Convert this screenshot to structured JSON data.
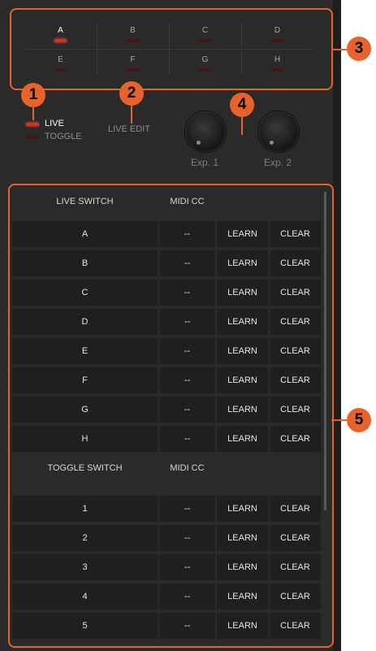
{
  "colors": {
    "accent": "#e8632b",
    "panel": "#2a2a2a",
    "led_on": "#d63125",
    "led_off": "#4a1414"
  },
  "switches": [
    {
      "label": "A",
      "active": true
    },
    {
      "label": "B",
      "active": false
    },
    {
      "label": "C",
      "active": false
    },
    {
      "label": "D",
      "active": false
    },
    {
      "label": "E",
      "active": false
    },
    {
      "label": "F",
      "active": false
    },
    {
      "label": "G",
      "active": false
    },
    {
      "label": "H",
      "active": false
    }
  ],
  "callouts": [
    "1",
    "2",
    "3",
    "4",
    "5"
  ],
  "modes": {
    "live": "LIVE",
    "toggle": "TOGGLE",
    "live_edit": "LIVE EDIT"
  },
  "expression": {
    "exp1": "Exp. 1",
    "exp2": "Exp. 2"
  },
  "live_section": {
    "header_name": "LIVE SWITCH",
    "header_cc": "MIDI CC",
    "rows": [
      {
        "name": "A",
        "cc": "--",
        "learn": "LEARN",
        "clear": "CLEAR"
      },
      {
        "name": "B",
        "cc": "--",
        "learn": "LEARN",
        "clear": "CLEAR"
      },
      {
        "name": "C",
        "cc": "--",
        "learn": "LEARN",
        "clear": "CLEAR"
      },
      {
        "name": "D",
        "cc": "--",
        "learn": "LEARN",
        "clear": "CLEAR"
      },
      {
        "name": "E",
        "cc": "--",
        "learn": "LEARN",
        "clear": "CLEAR"
      },
      {
        "name": "F",
        "cc": "--",
        "learn": "LEARN",
        "clear": "CLEAR"
      },
      {
        "name": "G",
        "cc": "--",
        "learn": "LEARN",
        "clear": "CLEAR"
      },
      {
        "name": "H",
        "cc": "--",
        "learn": "LEARN",
        "clear": "CLEAR"
      }
    ]
  },
  "toggle_section": {
    "header_name": "TOGGLE SWITCH",
    "header_cc": "MIDI CC",
    "rows": [
      {
        "name": "1",
        "cc": "--",
        "learn": "LEARN",
        "clear": "CLEAR"
      },
      {
        "name": "2",
        "cc": "--",
        "learn": "LEARN",
        "clear": "CLEAR"
      },
      {
        "name": "3",
        "cc": "--",
        "learn": "LEARN",
        "clear": "CLEAR"
      },
      {
        "name": "4",
        "cc": "--",
        "learn": "LEARN",
        "clear": "CLEAR"
      },
      {
        "name": "5",
        "cc": "--",
        "learn": "LEARN",
        "clear": "CLEAR"
      }
    ]
  }
}
